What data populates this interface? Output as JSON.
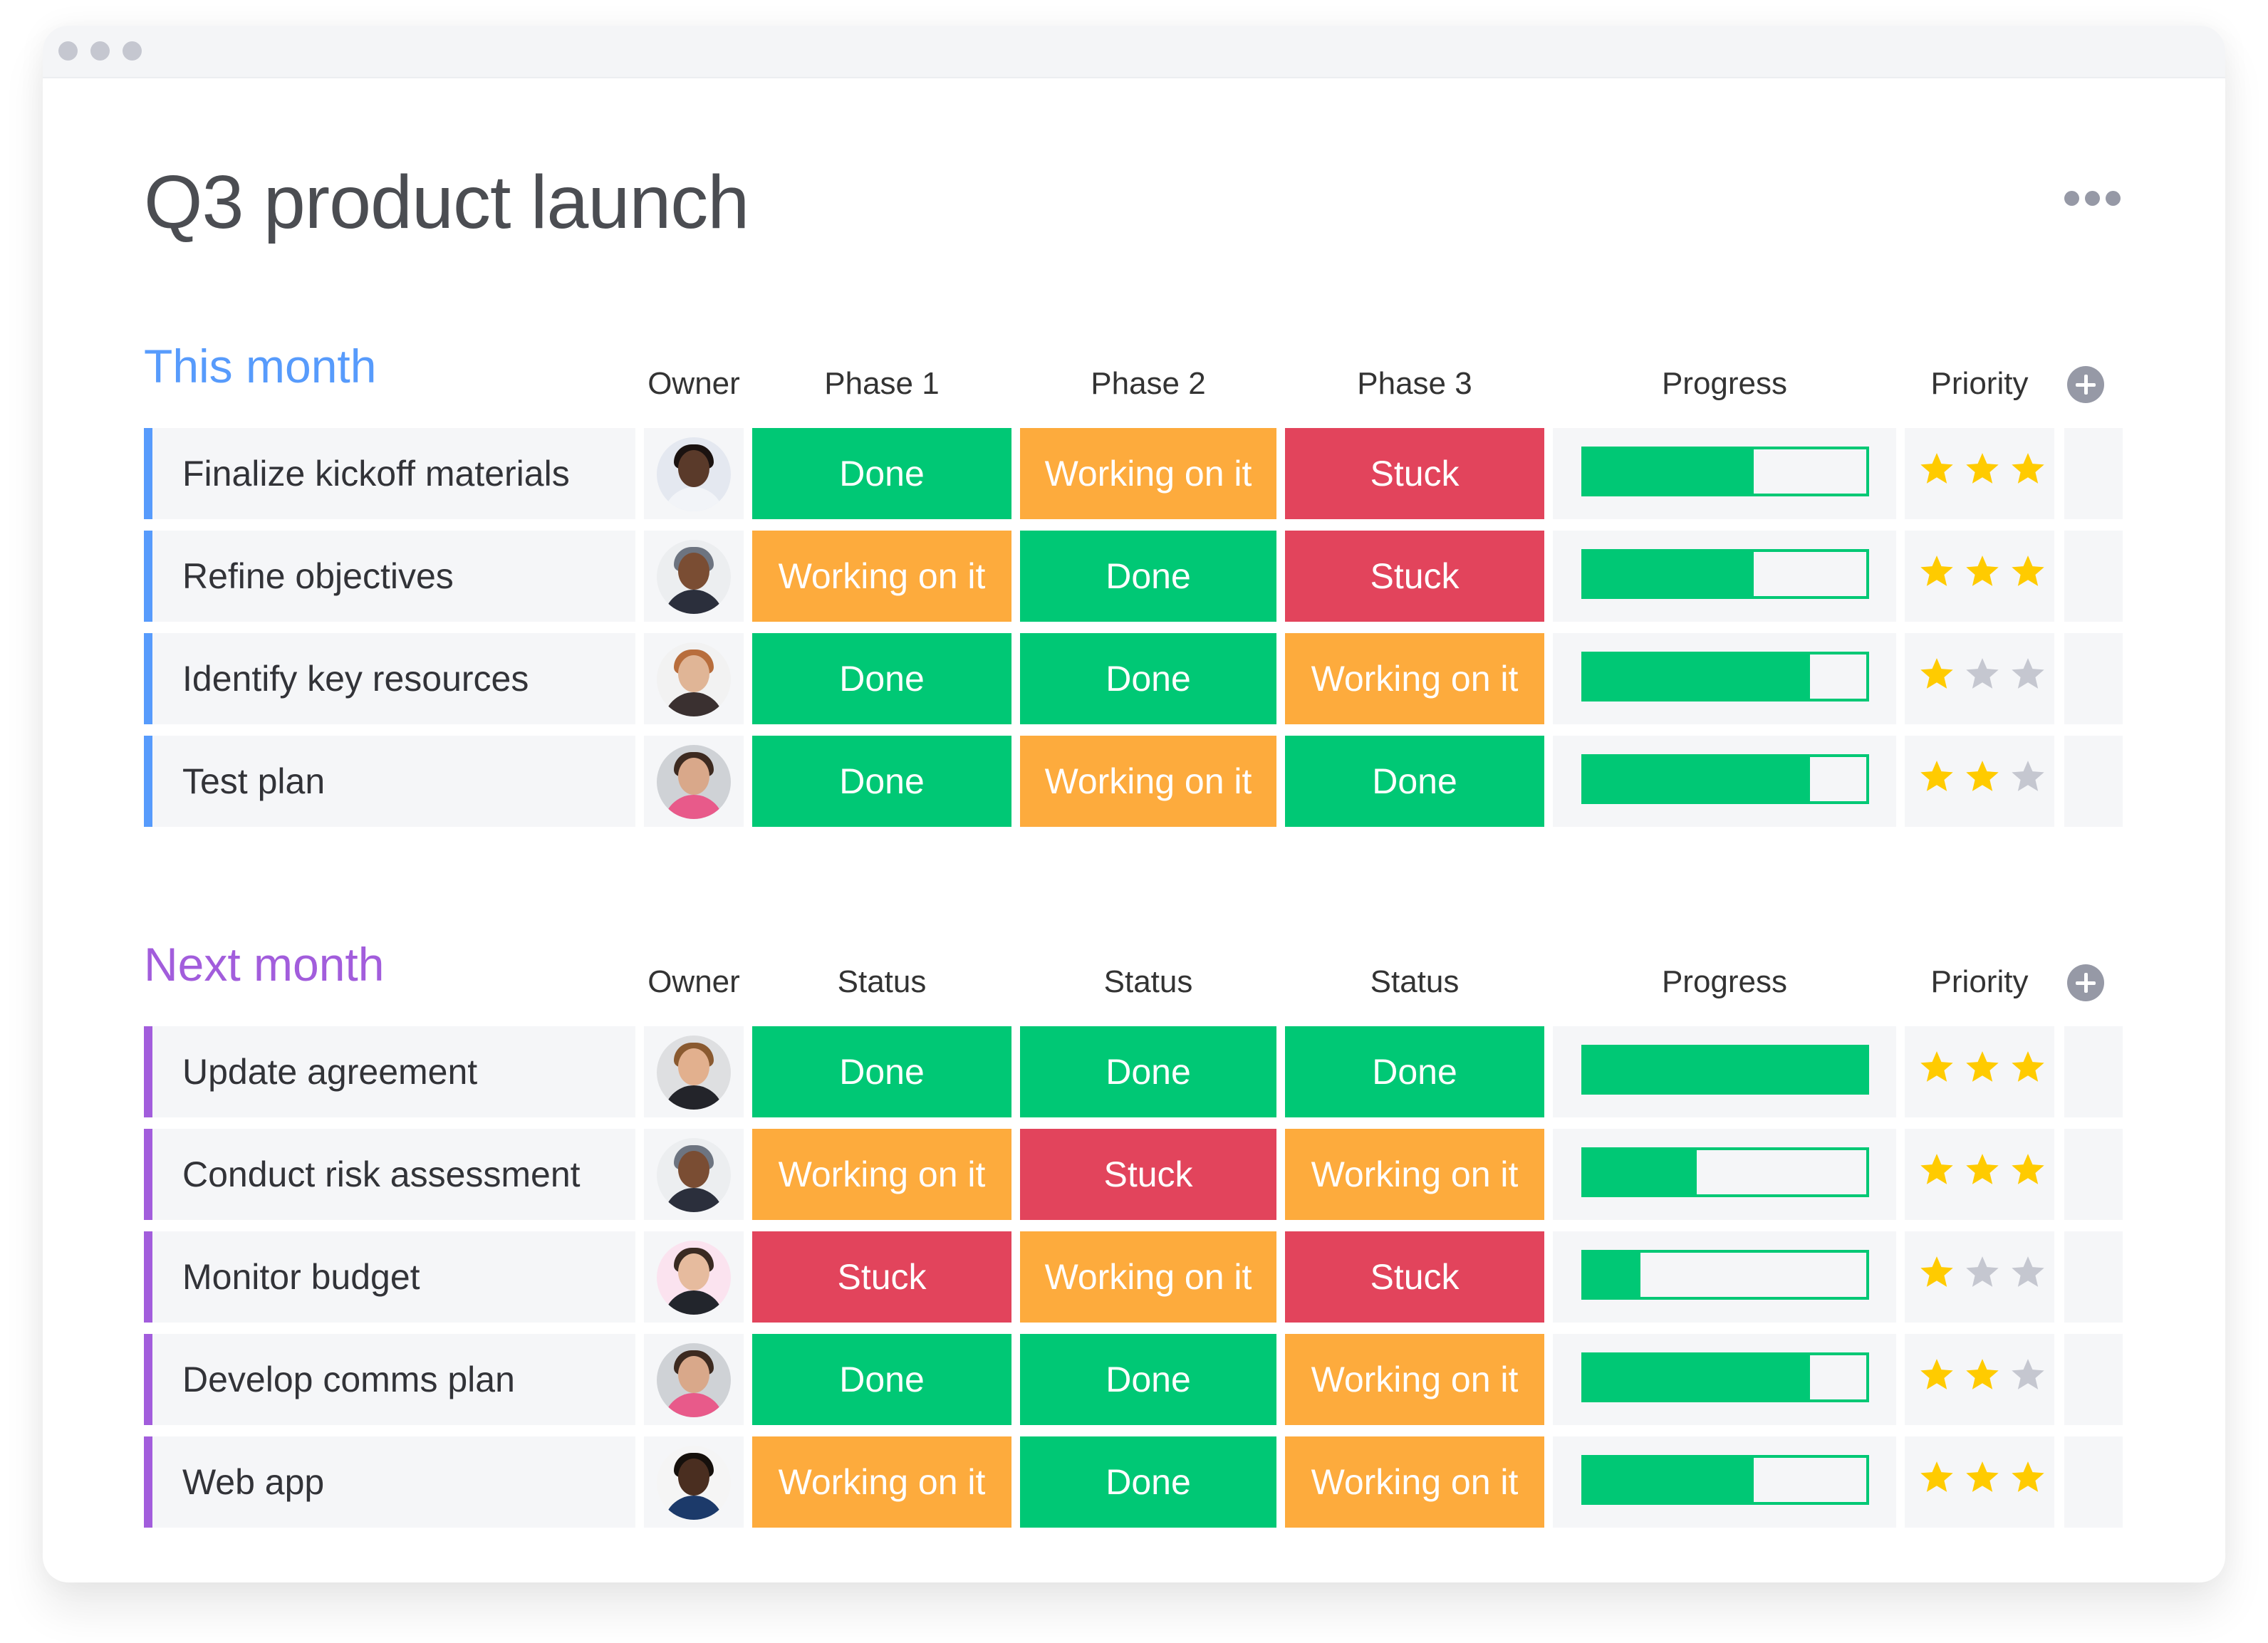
{
  "window": {
    "title_bar_dots": [
      "window-dot",
      "window-dot",
      "window-dot"
    ]
  },
  "page": {
    "title": "Q3 product launch",
    "more_icon": "more-horizontal-icon"
  },
  "colors": {
    "done": "#00c875",
    "working": "#fdab3d",
    "stuck": "#e2445c",
    "star_on": "#ffcb00",
    "star_off": "#c5c7d0",
    "group_this_month": "#579bfc",
    "group_next_month": "#a25ddc"
  },
  "groups": [
    {
      "title": "This month",
      "color": "#579bfc",
      "columns": {
        "owner": "Owner",
        "c1": "Phase 1",
        "c2": "Phase 2",
        "c3": "Phase 3",
        "progress": "Progress",
        "priority": "Priority"
      },
      "rows": [
        {
          "name": "Finalize kickoff materials",
          "owner": "avatar-1",
          "c1": "Done",
          "c2": "Working on it",
          "c3": "Stuck",
          "progress": 60,
          "priority": 3
        },
        {
          "name": "Refine objectives",
          "owner": "avatar-2",
          "c1": "Working on it",
          "c2": "Done",
          "c3": "Stuck",
          "progress": 60,
          "priority": 3
        },
        {
          "name": "Identify key resources",
          "owner": "avatar-3",
          "c1": "Done",
          "c2": "Done",
          "c3": "Working on it",
          "progress": 80,
          "priority": 1
        },
        {
          "name": "Test plan",
          "owner": "avatar-4",
          "c1": "Done",
          "c2": "Working on it",
          "c3": "Done",
          "progress": 80,
          "priority": 2
        }
      ]
    },
    {
      "title": "Next month",
      "color": "#a25ddc",
      "columns": {
        "owner": "Owner",
        "c1": "Status",
        "c2": "Status",
        "c3": "Status",
        "progress": "Progress",
        "priority": "Priority"
      },
      "rows": [
        {
          "name": "Update agreement",
          "owner": "avatar-5",
          "c1": "Done",
          "c2": "Done",
          "c3": "Done",
          "progress": 100,
          "priority": 3
        },
        {
          "name": "Conduct risk assessment",
          "owner": "avatar-2",
          "c1": "Working on it",
          "c2": "Stuck",
          "c3": "Working on it",
          "progress": 40,
          "priority": 3
        },
        {
          "name": "Monitor budget",
          "owner": "avatar-6",
          "c1": "Stuck",
          "c2": "Working on it",
          "c3": "Stuck",
          "progress": 20,
          "priority": 1
        },
        {
          "name": "Develop comms plan",
          "owner": "avatar-4",
          "c1": "Done",
          "c2": "Done",
          "c3": "Working on it",
          "progress": 80,
          "priority": 2
        },
        {
          "name": "Web app",
          "owner": "avatar-7",
          "c1": "Working on it",
          "c2": "Done",
          "c3": "Working on it",
          "progress": 60,
          "priority": 3
        }
      ]
    }
  ],
  "priority_max": 3
}
